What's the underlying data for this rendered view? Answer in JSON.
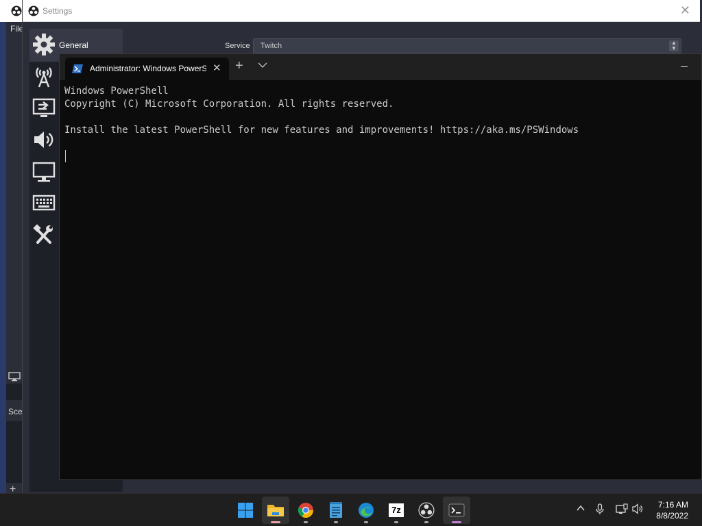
{
  "obs_main": {
    "menu_file": "File",
    "scenes_label": "Scene"
  },
  "settings": {
    "title": "Settings",
    "selected_category": "General",
    "category_icons": [
      "gear-icon",
      "stream-icon",
      "output-icon",
      "audio-icon",
      "video-icon",
      "hotkeys-icon",
      "advanced-icon"
    ],
    "service": {
      "label": "Service",
      "value": "Twitch"
    }
  },
  "terminal": {
    "tab_title": "Administrator: Windows PowerShell",
    "lines": {
      "line1": "Windows PowerShell",
      "line2": "Copyright (C) Microsoft Corporation. All rights reserved.",
      "line3": "",
      "line4": "Install the latest PowerShell for new features and improvements! https://aka.ms/PSWindows"
    }
  },
  "taskbar": {
    "apps": [
      "start-icon",
      "file-explorer-icon",
      "chrome-icon",
      "notepad-icon",
      "edge-icon",
      "7zip-icon",
      "obs-icon",
      "terminal-icon"
    ],
    "seven_zip_label": "7z",
    "clock": {
      "time": "7:16 AM",
      "date": "8/8/2022"
    }
  },
  "colors": {
    "terminal_bg": "#0c0c0c",
    "obs_bg": "#2b2e38",
    "taskbar_bg": "#1f1f1f",
    "active_indicator": "#c47fd6"
  }
}
